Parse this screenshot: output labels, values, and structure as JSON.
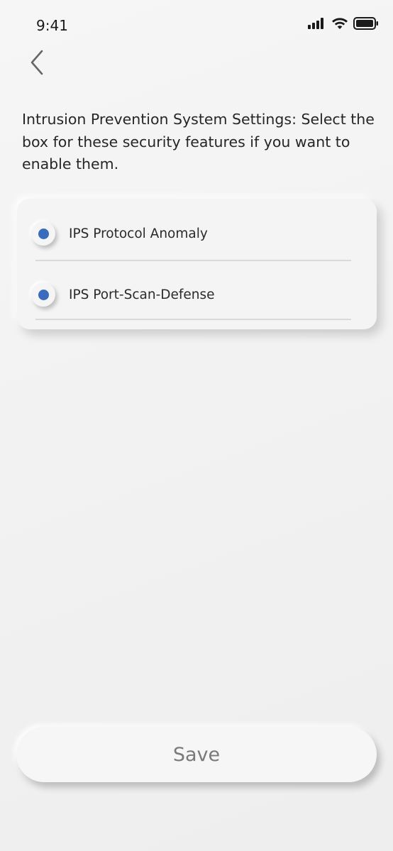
{
  "status_bar": {
    "time": "9:41",
    "icons": [
      "signal-icon",
      "wifi-icon",
      "battery-icon"
    ]
  },
  "header": {
    "back_icon": "chevron-left-icon"
  },
  "main": {
    "instructions": "Intrusion Prevention System Settings: Select the box for these security features if you want to enable them.",
    "options": [
      {
        "label": "IPS Protocol Anomaly",
        "selected": true
      },
      {
        "label": "IPS Port-Scan-Defense",
        "selected": true
      }
    ]
  },
  "footer": {
    "save_label": "Save"
  },
  "colors": {
    "accent": "#3a6bbd",
    "background": "#f2f2f2",
    "button_text": "#7a7a7a"
  }
}
